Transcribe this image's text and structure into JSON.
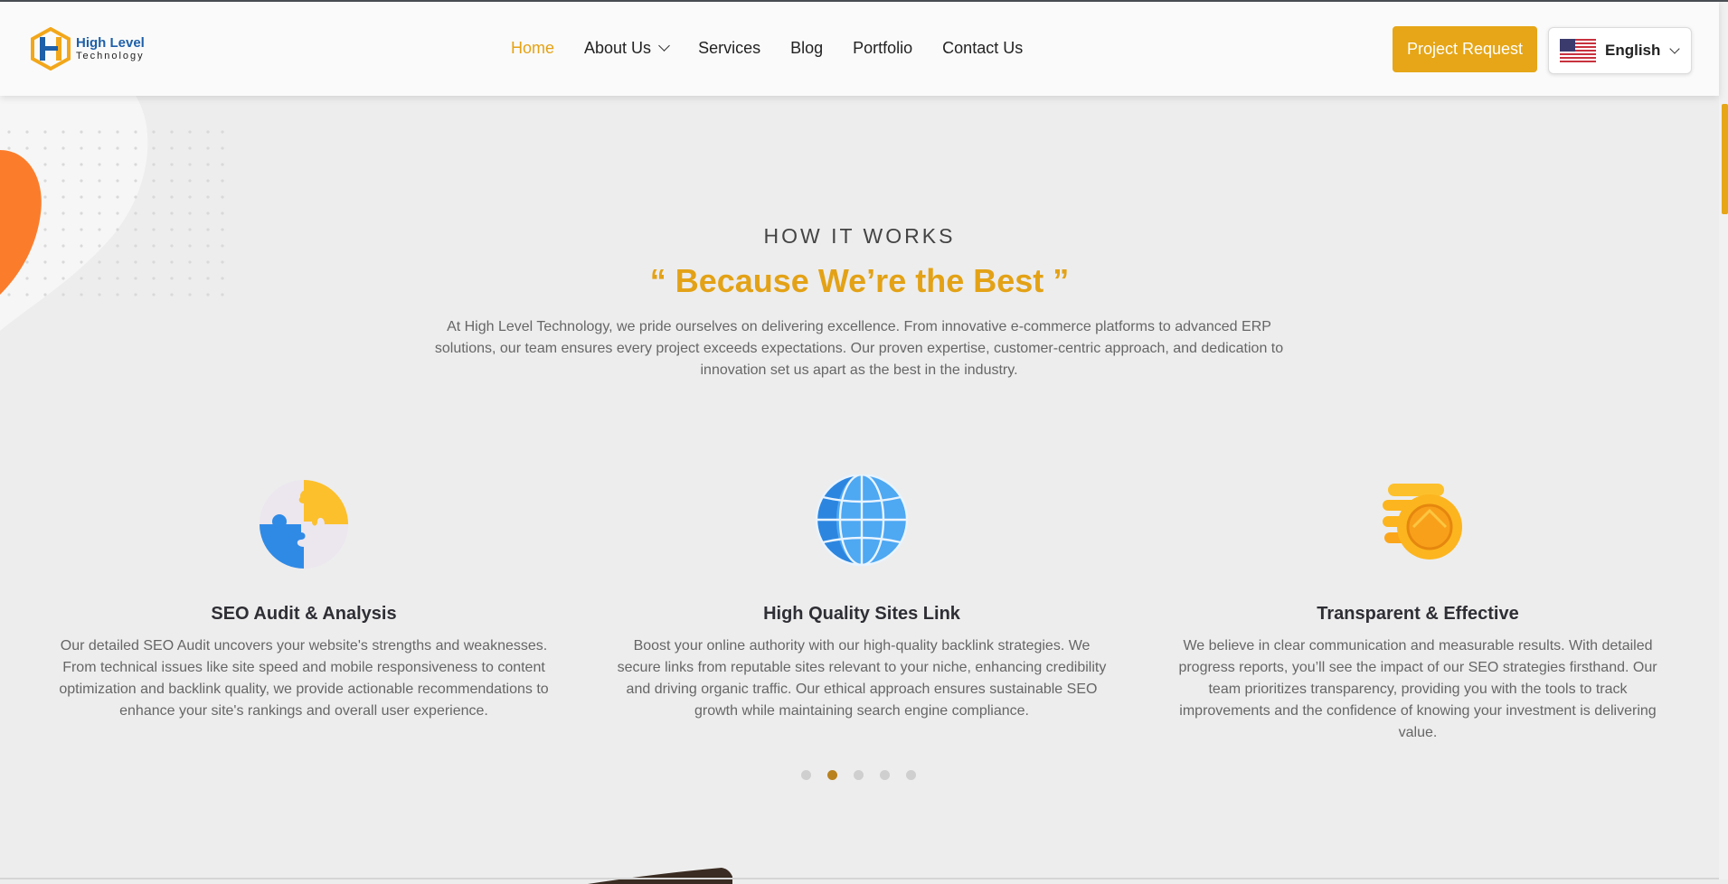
{
  "brand": {
    "name_line1": "High Level",
    "name_line2": "Technology",
    "colors": {
      "accent": "#e6a617",
      "blue": "#1d5fa8"
    }
  },
  "nav": {
    "items": [
      {
        "label": "Home",
        "active": true
      },
      {
        "label": "About Us",
        "dropdown": true
      },
      {
        "label": "Services"
      },
      {
        "label": "Blog"
      },
      {
        "label": "Portfolio"
      },
      {
        "label": "Contact Us"
      }
    ]
  },
  "header": {
    "cta_label": "Project Request",
    "language": "English",
    "flag_icon": "us-flag-icon"
  },
  "section": {
    "subtitle": "HOW  IT  WORKS",
    "title": "“ Because We’re the Best ”",
    "description": "At High Level Technology, we pride ourselves on delivering excellence. From innovative e-commerce platforms to advanced ERP solutions, our team ensures every project exceeds expectations. Our proven expertise, customer-centric approach, and dedication to innovation set us apart as the best in the industry."
  },
  "cards": [
    {
      "icon": "puzzle-icon",
      "title": "SEO Audit & Analysis",
      "text": "Our detailed SEO Audit uncovers your website's strengths and weaknesses. From technical issues like site speed and mobile responsiveness to content optimization and backlink quality, we provide actionable recommendations to enhance your site's rankings and overall user experience."
    },
    {
      "icon": "globe-icon",
      "title": "High Quality Sites Link",
      "text": "Boost your online authority with our high-quality backlink strategies. We secure links from reputable sites relevant to your niche, enhancing credibility and driving organic traffic. Our ethical approach ensures sustainable SEO growth while maintaining search engine compliance."
    },
    {
      "icon": "coin-icon",
      "title": "Transparent & Effective",
      "text": "We believe in clear communication and measurable results. With detailed progress reports, you’ll see the impact of our SEO strategies firsthand. Our team prioritizes transparency, providing you with the tools to track improvements and the confidence of knowing your investment is delivering value."
    }
  ],
  "carousel": {
    "total": 5,
    "active_index": 1
  }
}
